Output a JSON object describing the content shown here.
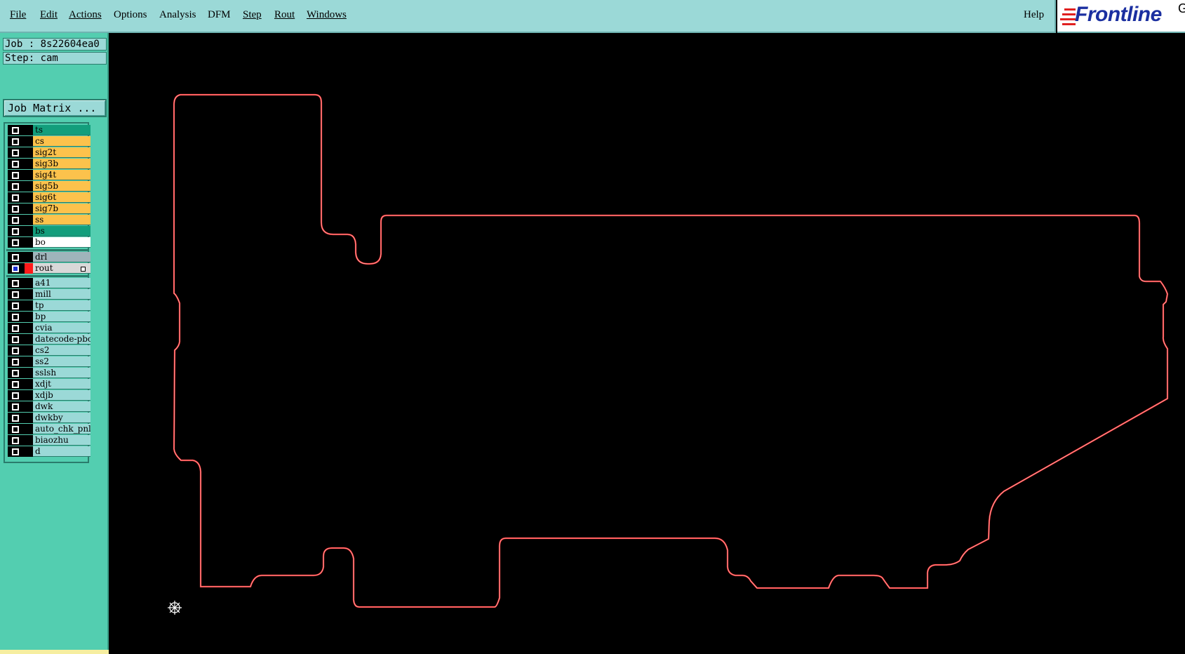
{
  "menu": {
    "items": [
      "File",
      "Edit",
      "Actions",
      "Options",
      "Analysis",
      "DFM",
      "Step",
      "Rout",
      "Windows"
    ],
    "help": "Help"
  },
  "logo": {
    "text": "Frontline",
    "extra": "G"
  },
  "job": {
    "label": "Job : 8s22604ea0"
  },
  "step": {
    "label": "Step: cam"
  },
  "job_matrix": {
    "label": "Job Matrix ..."
  },
  "layers": {
    "board": [
      {
        "name": "ts",
        "color": "#139e7c"
      },
      {
        "name": "cs",
        "color": "#fcc24c"
      },
      {
        "name": "sig2t",
        "color": "#fcc24c"
      },
      {
        "name": "sig3b",
        "color": "#fcc24c"
      },
      {
        "name": "sig4t",
        "color": "#fcc24c"
      },
      {
        "name": "sig5b",
        "color": "#fcc24c"
      },
      {
        "name": "sig6t",
        "color": "#fcc24c"
      },
      {
        "name": "sig7b",
        "color": "#fcc24c"
      },
      {
        "name": "ss",
        "color": "#fcc24c"
      },
      {
        "name": "bs",
        "color": "#139e7c"
      },
      {
        "name": "bo",
        "color": "#ffffff"
      }
    ],
    "drill": [
      {
        "name": "drl",
        "color": "#9fb4bb"
      },
      {
        "name": "rout",
        "color": "#d8d8d8",
        "active": true
      }
    ],
    "misc": [
      {
        "name": "a41"
      },
      {
        "name": "mill"
      },
      {
        "name": "tp"
      },
      {
        "name": "bp"
      },
      {
        "name": "cvia"
      },
      {
        "name": "datecode-pbc"
      },
      {
        "name": "cs2"
      },
      {
        "name": "ss2"
      },
      {
        "name": "sslsh"
      },
      {
        "name": "xdjt"
      },
      {
        "name": "xdjb"
      },
      {
        "name": "dwk"
      },
      {
        "name": "dwkby"
      },
      {
        "name": "auto_chk_pnl"
      },
      {
        "name": "biaozhu"
      },
      {
        "name": "d"
      }
    ],
    "misc_color": "#9bd9d7"
  },
  "colors": {
    "menubar": "#9bd9d7",
    "panel": "#53ceb0",
    "outline": "#ff3b3b",
    "canvas": "#000000"
  },
  "icons": {
    "origin": "origin-icon",
    "rout_marker": "rout-marker-icon"
  }
}
